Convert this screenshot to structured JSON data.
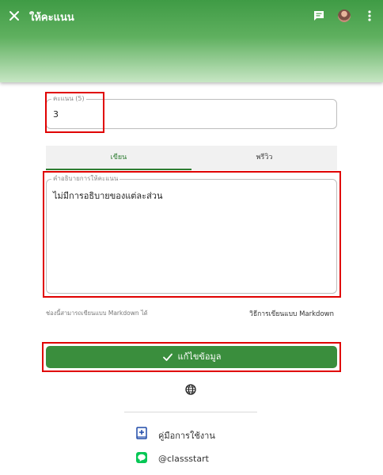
{
  "header": {
    "title": "ให้คะแนน",
    "close_icon": "close-icon",
    "chat_icon": "chat-icon",
    "more_icon": "more-vert-icon"
  },
  "score": {
    "label": "คะแนน (5)",
    "value": "3"
  },
  "tabs": [
    {
      "label": "เขียน",
      "active": true
    },
    {
      "label": "พรีวิว",
      "active": false
    }
  ],
  "description": {
    "label": "คำอธิบายการให้คะแนน",
    "value": "ไม่มีการอธิบายของแต่ละส่วน"
  },
  "markdown": {
    "hint": "ช่องนี้สามารถเขียนแบบ Markdown ได้",
    "link": "วิธีการเขียนแบบ Markdown"
  },
  "save_button": {
    "label": "แก้ไขข้อมูล",
    "color": "#3a8e3d"
  },
  "footer": {
    "manual_label": "คู่มือการใช้งาน",
    "line_label": "@classstart"
  },
  "colors": {
    "accent": "#2e7d32",
    "highlight": "#e00000"
  }
}
